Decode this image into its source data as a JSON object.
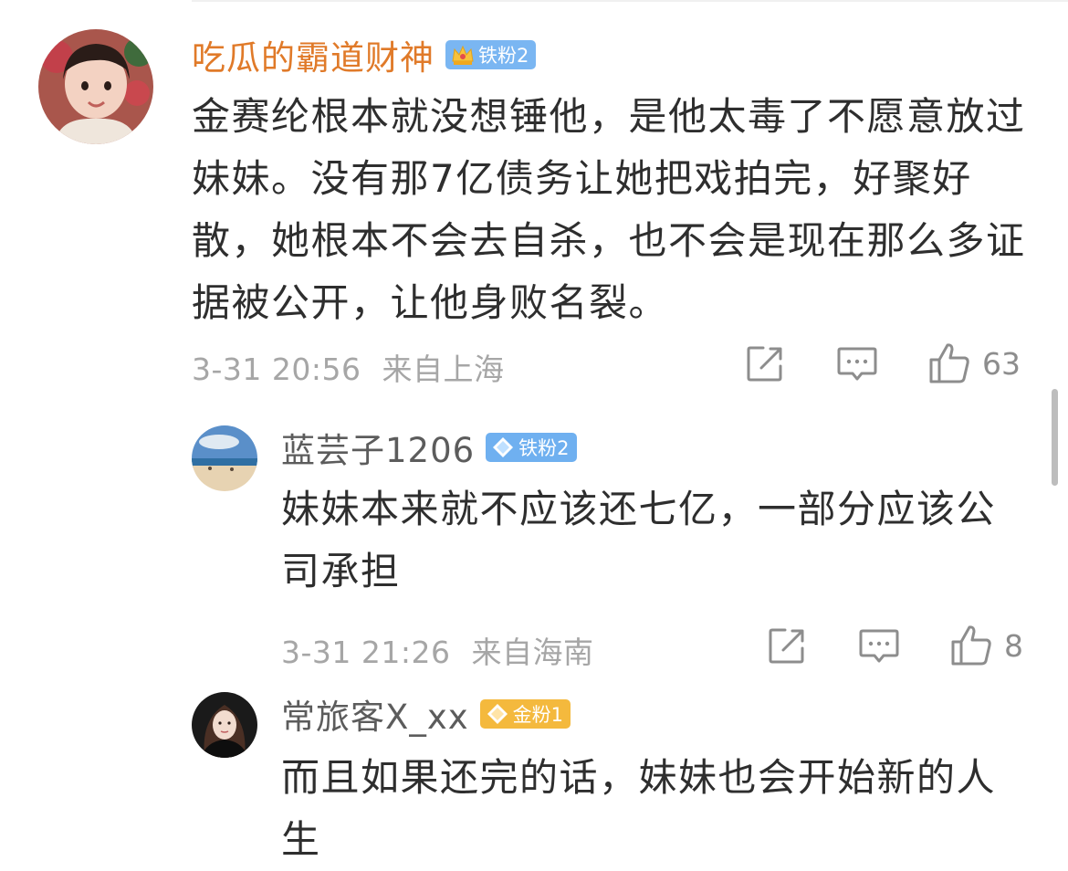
{
  "comments": [
    {
      "author": "吃瓜的霸道财神",
      "badge": "铁粉2",
      "badge_type": "crown",
      "content": "金赛纶根本就没想锤他，是他太毒了不愿意放过妹妹。没有那7亿债务让她把戏拍完，好聚好散，她根本不会去自杀，也不会是现在那么多证据被公开，让他身败名裂。",
      "time": "3-31 20:56",
      "location": "来自上海",
      "likes": "63"
    },
    {
      "author": "蓝芸子1206",
      "badge": "铁粉2",
      "badge_type": "diamond",
      "content": "妹妹本来就不应该还七亿，一部分应该公司承担",
      "time": "3-31 21:26",
      "location": "来自海南",
      "likes": "8"
    },
    {
      "author": "常旅客X_xx",
      "badge": "金粉1",
      "badge_type": "gold",
      "content": "而且如果还完的话，妹妹也会开始新的人生"
    }
  ],
  "colors": {
    "vip_name": "#e07a29",
    "name": "#5c5c5c",
    "iron_badge": "#6fb0f0",
    "gold_badge": "#f4b93d",
    "meta": "#a6a6a6"
  },
  "icons": [
    "repost-icon",
    "comment-icon",
    "like-icon",
    "crown-icon",
    "diamond-icon"
  ]
}
